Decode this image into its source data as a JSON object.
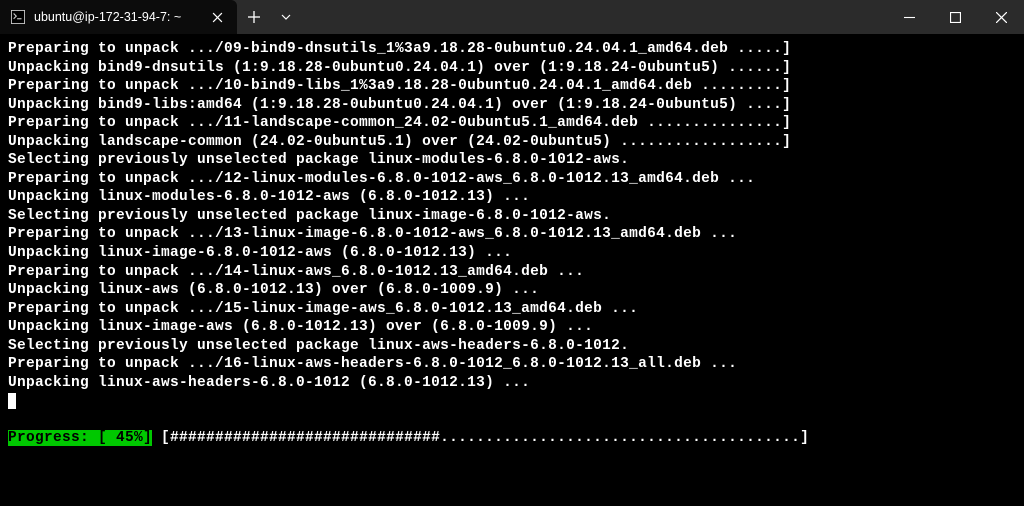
{
  "window": {
    "tab_title": "ubuntu@ip-172-31-94-7: ~"
  },
  "terminal": {
    "lines": [
      "Preparing to unpack .../09-bind9-dnsutils_1%3a9.18.28-0ubuntu0.24.04.1_amd64.deb .....]",
      "Unpacking bind9-dnsutils (1:9.18.28-0ubuntu0.24.04.1) over (1:9.18.24-0ubuntu5) ......]",
      "Preparing to unpack .../10-bind9-libs_1%3a9.18.28-0ubuntu0.24.04.1_amd64.deb .........]",
      "Unpacking bind9-libs:amd64 (1:9.18.28-0ubuntu0.24.04.1) over (1:9.18.24-0ubuntu5) ....]",
      "Preparing to unpack .../11-landscape-common_24.02-0ubuntu5.1_amd64.deb ...............]",
      "Unpacking landscape-common (24.02-0ubuntu5.1) over (24.02-0ubuntu5) ..................]",
      "Selecting previously unselected package linux-modules-6.8.0-1012-aws.",
      "Preparing to unpack .../12-linux-modules-6.8.0-1012-aws_6.8.0-1012.13_amd64.deb ...",
      "Unpacking linux-modules-6.8.0-1012-aws (6.8.0-1012.13) ...",
      "Selecting previously unselected package linux-image-6.8.0-1012-aws.",
      "Preparing to unpack .../13-linux-image-6.8.0-1012-aws_6.8.0-1012.13_amd64.deb ...",
      "Unpacking linux-image-6.8.0-1012-aws (6.8.0-1012.13) ...",
      "Preparing to unpack .../14-linux-aws_6.8.0-1012.13_amd64.deb ...",
      "Unpacking linux-aws (6.8.0-1012.13) over (6.8.0-1009.9) ...",
      "Preparing to unpack .../15-linux-image-aws_6.8.0-1012.13_amd64.deb ...",
      "Unpacking linux-image-aws (6.8.0-1012.13) over (6.8.0-1009.9) ...",
      "Selecting previously unselected package linux-aws-headers-6.8.0-1012.",
      "Preparing to unpack .../16-linux-aws-headers-6.8.0-1012_6.8.0-1012.13_all.deb ...",
      "Unpacking linux-aws-headers-6.8.0-1012 (6.8.0-1012.13) ..."
    ],
    "progress_label": "Progress: [ 45%]",
    "progress_bar": " [##############################........................................] "
  }
}
